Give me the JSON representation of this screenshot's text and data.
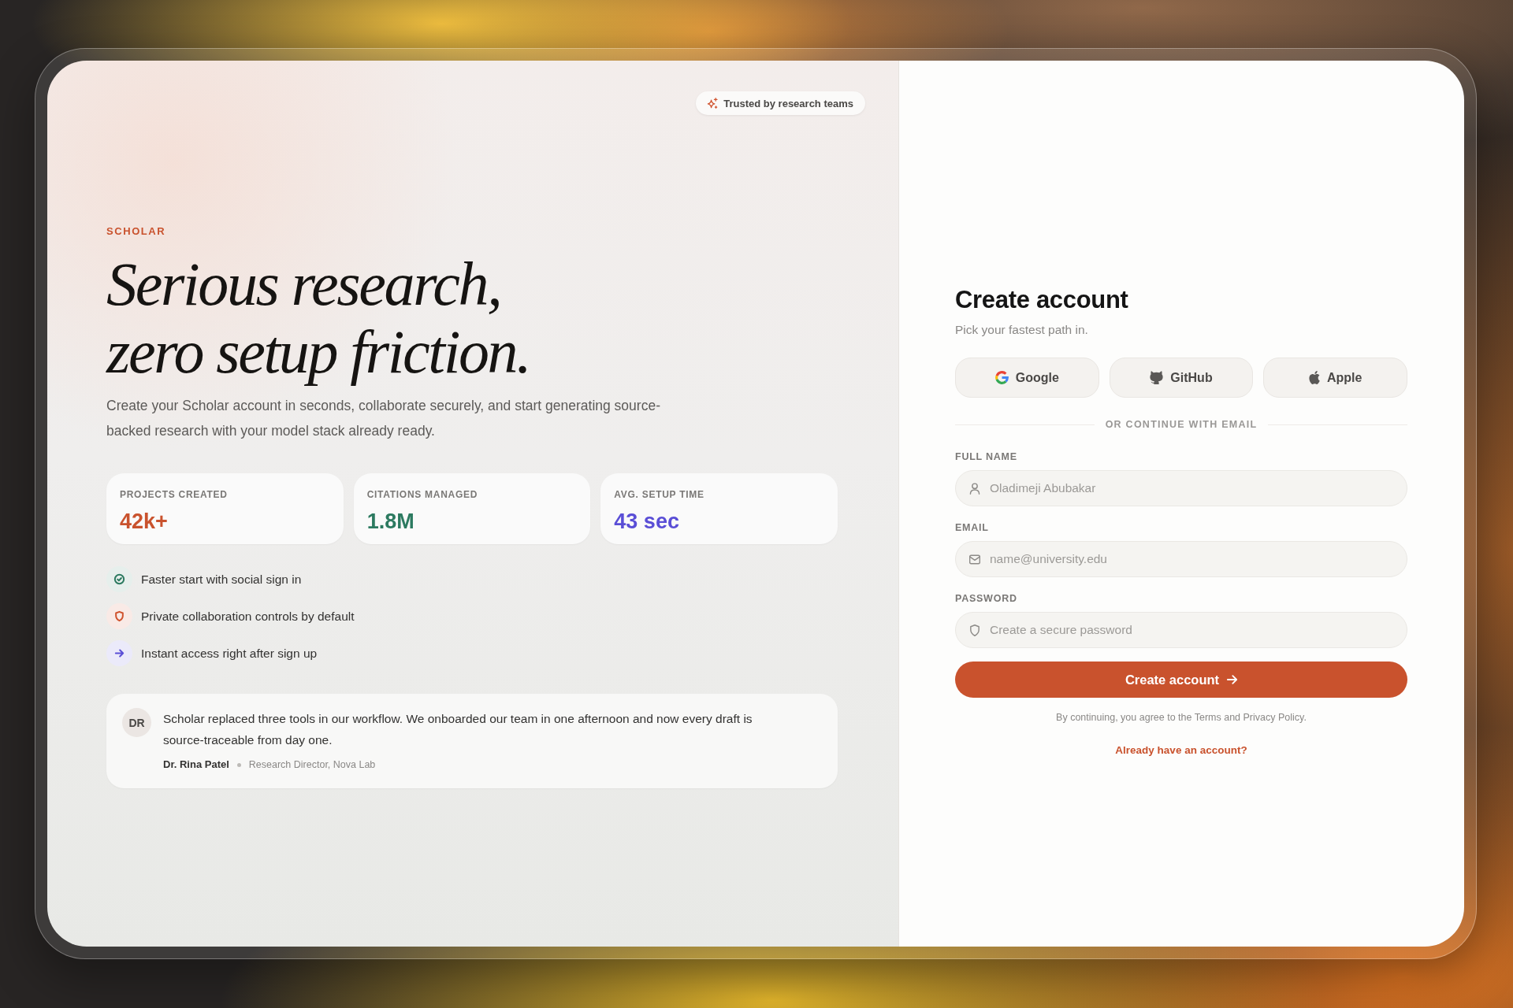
{
  "badge": {
    "text": "Trusted by research teams"
  },
  "hero": {
    "eyebrow": "SCHOLAR",
    "title_lines": [
      "Serious research,",
      "zero setup friction."
    ],
    "description": "Create your Scholar account in seconds, collaborate securely, and start generating source-backed research with your model stack already ready."
  },
  "stats": [
    {
      "label": "PROJECTS CREATED",
      "value": "42k+",
      "color": "#c9522d"
    },
    {
      "label": "CITATIONS MANAGED",
      "value": "1.8M",
      "color": "#2c7a60"
    },
    {
      "label": "AVG. SETUP TIME",
      "value": "43 sec",
      "color": "#5a4ed6"
    }
  ],
  "features": [
    {
      "kind": "check",
      "text": "Faster start with social sign in",
      "color": "#2c7a60"
    },
    {
      "kind": "shield",
      "text": "Private collaboration controls by default",
      "color": "#d0532e"
    },
    {
      "kind": "arrow",
      "text": "Instant access right after sign up",
      "color": "#5a4ed6"
    }
  ],
  "testimonial": {
    "initials": "DR",
    "quote": "Scholar replaced three tools in our workflow. We onboarded our team in one afternoon and now every draft is source-traceable from day one.",
    "author": "Dr. Rina Patel",
    "role": "Research Director, Nova Lab"
  },
  "signup": {
    "title": "Create account",
    "subtitle": "Pick your fastest path in.",
    "social_buttons": [
      {
        "kind": "google",
        "label": "Google"
      },
      {
        "kind": "github",
        "label": "GitHub"
      },
      {
        "kind": "apple",
        "label": "Apple"
      }
    ],
    "divider": "OR CONTINUE WITH EMAIL",
    "fields": [
      {
        "kind": "person",
        "label": "FULL NAME",
        "placeholder": "Oladimeji Abubakar"
      },
      {
        "kind": "mail",
        "label": "EMAIL",
        "placeholder": "name@university.edu"
      },
      {
        "kind": "lock",
        "label": "PASSWORD",
        "placeholder": "Create a secure password"
      }
    ],
    "submit": "Create account",
    "terms": "By continuing, you agree to the Terms and Privacy Policy.",
    "signin_link": "Already have an account?"
  }
}
